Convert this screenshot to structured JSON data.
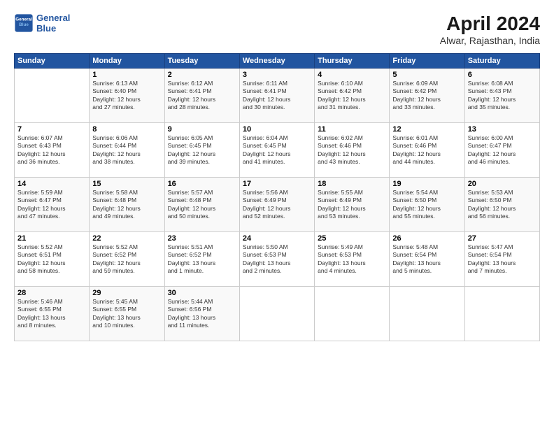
{
  "header": {
    "logo_line1": "General",
    "logo_line2": "Blue",
    "month": "April 2024",
    "location": "Alwar, Rajasthan, India"
  },
  "weekdays": [
    "Sunday",
    "Monday",
    "Tuesday",
    "Wednesday",
    "Thursday",
    "Friday",
    "Saturday"
  ],
  "weeks": [
    [
      {
        "day": "",
        "info": ""
      },
      {
        "day": "1",
        "info": "Sunrise: 6:13 AM\nSunset: 6:40 PM\nDaylight: 12 hours\nand 27 minutes."
      },
      {
        "day": "2",
        "info": "Sunrise: 6:12 AM\nSunset: 6:41 PM\nDaylight: 12 hours\nand 28 minutes."
      },
      {
        "day": "3",
        "info": "Sunrise: 6:11 AM\nSunset: 6:41 PM\nDaylight: 12 hours\nand 30 minutes."
      },
      {
        "day": "4",
        "info": "Sunrise: 6:10 AM\nSunset: 6:42 PM\nDaylight: 12 hours\nand 31 minutes."
      },
      {
        "day": "5",
        "info": "Sunrise: 6:09 AM\nSunset: 6:42 PM\nDaylight: 12 hours\nand 33 minutes."
      },
      {
        "day": "6",
        "info": "Sunrise: 6:08 AM\nSunset: 6:43 PM\nDaylight: 12 hours\nand 35 minutes."
      }
    ],
    [
      {
        "day": "7",
        "info": "Sunrise: 6:07 AM\nSunset: 6:43 PM\nDaylight: 12 hours\nand 36 minutes."
      },
      {
        "day": "8",
        "info": "Sunrise: 6:06 AM\nSunset: 6:44 PM\nDaylight: 12 hours\nand 38 minutes."
      },
      {
        "day": "9",
        "info": "Sunrise: 6:05 AM\nSunset: 6:45 PM\nDaylight: 12 hours\nand 39 minutes."
      },
      {
        "day": "10",
        "info": "Sunrise: 6:04 AM\nSunset: 6:45 PM\nDaylight: 12 hours\nand 41 minutes."
      },
      {
        "day": "11",
        "info": "Sunrise: 6:02 AM\nSunset: 6:46 PM\nDaylight: 12 hours\nand 43 minutes."
      },
      {
        "day": "12",
        "info": "Sunrise: 6:01 AM\nSunset: 6:46 PM\nDaylight: 12 hours\nand 44 minutes."
      },
      {
        "day": "13",
        "info": "Sunrise: 6:00 AM\nSunset: 6:47 PM\nDaylight: 12 hours\nand 46 minutes."
      }
    ],
    [
      {
        "day": "14",
        "info": "Sunrise: 5:59 AM\nSunset: 6:47 PM\nDaylight: 12 hours\nand 47 minutes."
      },
      {
        "day": "15",
        "info": "Sunrise: 5:58 AM\nSunset: 6:48 PM\nDaylight: 12 hours\nand 49 minutes."
      },
      {
        "day": "16",
        "info": "Sunrise: 5:57 AM\nSunset: 6:48 PM\nDaylight: 12 hours\nand 50 minutes."
      },
      {
        "day": "17",
        "info": "Sunrise: 5:56 AM\nSunset: 6:49 PM\nDaylight: 12 hours\nand 52 minutes."
      },
      {
        "day": "18",
        "info": "Sunrise: 5:55 AM\nSunset: 6:49 PM\nDaylight: 12 hours\nand 53 minutes."
      },
      {
        "day": "19",
        "info": "Sunrise: 5:54 AM\nSunset: 6:50 PM\nDaylight: 12 hours\nand 55 minutes."
      },
      {
        "day": "20",
        "info": "Sunrise: 5:53 AM\nSunset: 6:50 PM\nDaylight: 12 hours\nand 56 minutes."
      }
    ],
    [
      {
        "day": "21",
        "info": "Sunrise: 5:52 AM\nSunset: 6:51 PM\nDaylight: 12 hours\nand 58 minutes."
      },
      {
        "day": "22",
        "info": "Sunrise: 5:52 AM\nSunset: 6:52 PM\nDaylight: 12 hours\nand 59 minutes."
      },
      {
        "day": "23",
        "info": "Sunrise: 5:51 AM\nSunset: 6:52 PM\nDaylight: 13 hours\nand 1 minute."
      },
      {
        "day": "24",
        "info": "Sunrise: 5:50 AM\nSunset: 6:53 PM\nDaylight: 13 hours\nand 2 minutes."
      },
      {
        "day": "25",
        "info": "Sunrise: 5:49 AM\nSunset: 6:53 PM\nDaylight: 13 hours\nand 4 minutes."
      },
      {
        "day": "26",
        "info": "Sunrise: 5:48 AM\nSunset: 6:54 PM\nDaylight: 13 hours\nand 5 minutes."
      },
      {
        "day": "27",
        "info": "Sunrise: 5:47 AM\nSunset: 6:54 PM\nDaylight: 13 hours\nand 7 minutes."
      }
    ],
    [
      {
        "day": "28",
        "info": "Sunrise: 5:46 AM\nSunset: 6:55 PM\nDaylight: 13 hours\nand 8 minutes."
      },
      {
        "day": "29",
        "info": "Sunrise: 5:45 AM\nSunset: 6:55 PM\nDaylight: 13 hours\nand 10 minutes."
      },
      {
        "day": "30",
        "info": "Sunrise: 5:44 AM\nSunset: 6:56 PM\nDaylight: 13 hours\nand 11 minutes."
      },
      {
        "day": "",
        "info": ""
      },
      {
        "day": "",
        "info": ""
      },
      {
        "day": "",
        "info": ""
      },
      {
        "day": "",
        "info": ""
      }
    ]
  ]
}
